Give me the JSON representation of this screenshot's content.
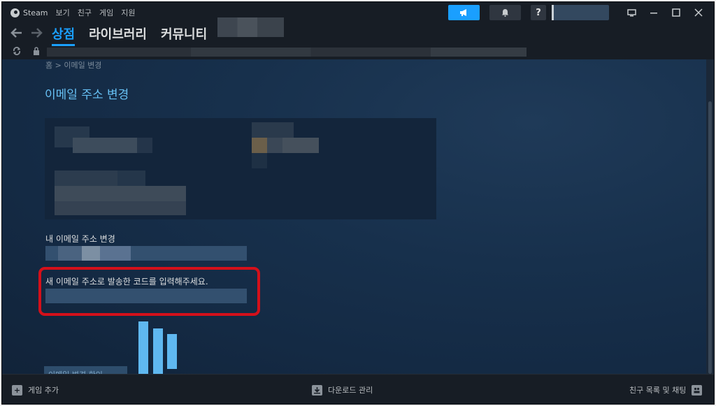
{
  "menubar": {
    "brand": "Steam",
    "items": [
      "보기",
      "친구",
      "게임",
      "지원"
    ],
    "help_label": "?"
  },
  "nav": {
    "tabs": [
      {
        "label": "상점",
        "active": true
      },
      {
        "label": "라이브러리",
        "active": false
      },
      {
        "label": "커뮤니티",
        "active": false
      }
    ]
  },
  "page": {
    "breadcrumb": "홈 > 이메일 변경",
    "title": "이메일 주소 변경",
    "current_email_label": "내 이메일 주소 변경",
    "code_label": "새 이메일 주소로 발송한 코드를 입력해주세요.",
    "submit_label": "이메일 변경 확인"
  },
  "footer": {
    "add_game": "게임 추가",
    "downloads": "다운로드 관리",
    "friends_chat": "친구 목록 및 채팅"
  },
  "colors": {
    "accent": "#1a9fff",
    "title_blue": "#67c1f5",
    "highlight_red": "#d4101a"
  },
  "icons": [
    "steam-logo-icon",
    "megaphone-icon",
    "bell-icon",
    "monitor-icon",
    "minimize-icon",
    "maximize-icon",
    "close-icon",
    "back-arrow-icon",
    "forward-arrow-icon",
    "reload-icon",
    "lock-icon",
    "add-game-icon",
    "download-icon",
    "friends-chat-icon"
  ]
}
